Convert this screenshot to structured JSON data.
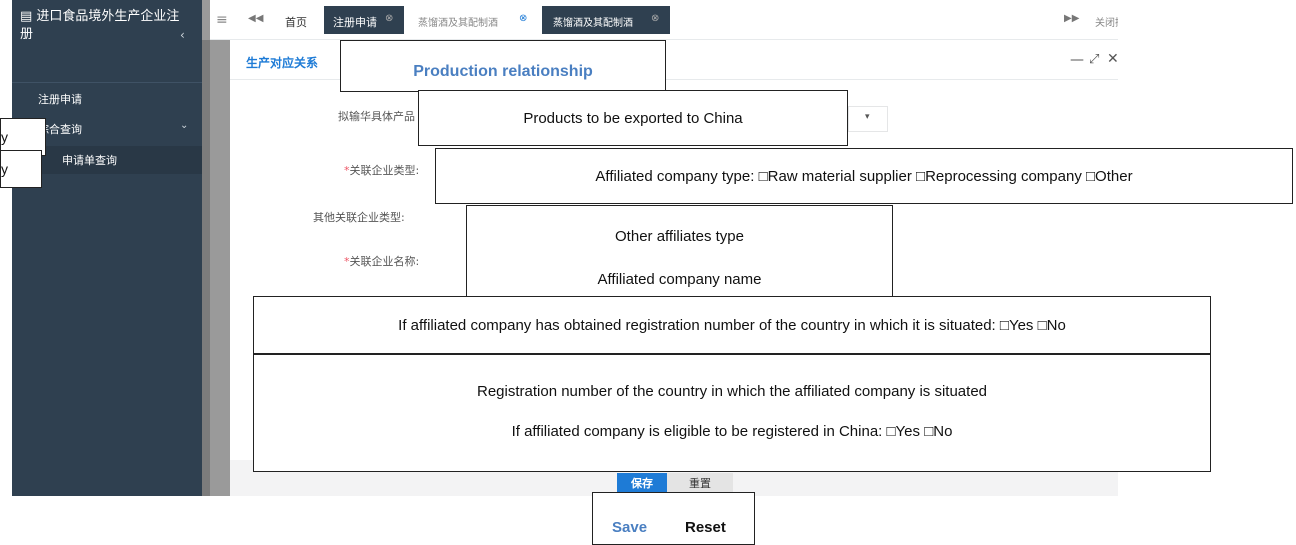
{
  "sidebar": {
    "title": "进口食品境外生产企业注册",
    "title_icon": "form-icon",
    "items": [
      {
        "label": "注册申请"
      },
      {
        "label": "综合查询",
        "sub": [
          {
            "label": "申请单查询"
          }
        ]
      }
    ]
  },
  "tabs": {
    "home": "首页",
    "registration": "注册申请",
    "wine1": "蒸馏酒及其配制酒",
    "wine2": "蒸馏酒及其配制酒",
    "close_ops": "关闭操作"
  },
  "panel": {
    "title": "生产对应关系",
    "labels": {
      "products": "拟输华具体产品",
      "affiliated_type": "关联企业类型:",
      "other_type": "其他关联企业类型:",
      "affiliated_name": "关联企业名称:"
    },
    "required_mark": "*",
    "buttons": {
      "save": "保存",
      "reset": "重置"
    }
  },
  "annotations": {
    "production_relationship": "Production relationship",
    "left_1": "y",
    "left_2": "y",
    "products": "Products to be exported to China",
    "affiliated_type": "Affiliated company type: □Raw material supplier □Reprocessing company □Other",
    "other_type": "Other affiliates type",
    "affiliated_name": "Affiliated company name",
    "obtained": "If affiliated company has obtained registration number of the country in which it is situated: □Yes □No",
    "reg_number": "Registration number of the country in which the affiliated company is situated",
    "eligible": "If affiliated company is eligible to be registered in China: □Yes □No",
    "save": "Save",
    "reset": "Reset"
  },
  "colors": {
    "sidebar": "#2f4050",
    "accent": "#1e7bd6",
    "annotation_blue": "#4a7fc1"
  }
}
